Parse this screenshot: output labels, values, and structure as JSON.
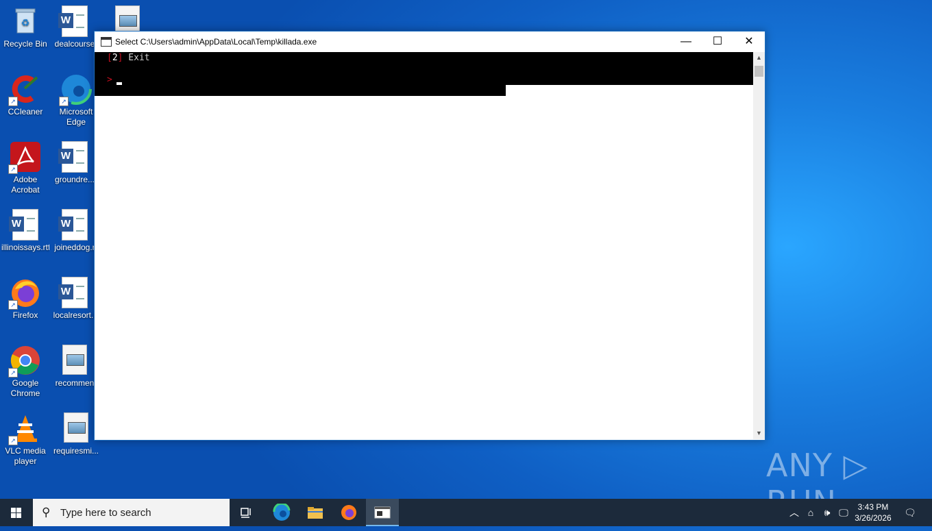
{
  "desktop": {
    "icons": [
      {
        "label": "Recycle Bin"
      },
      {
        "label": "dealcourse"
      },
      {
        "label": ""
      },
      {
        "label": "CCleaner"
      },
      {
        "label": "Microsoft Edge"
      },
      {
        "label": "Adobe Acrobat"
      },
      {
        "label": "groundre..."
      },
      {
        "label": "illinoissays.rtf"
      },
      {
        "label": "joineddog.r"
      },
      {
        "label": "Firefox"
      },
      {
        "label": "localresort.r"
      },
      {
        "label": "Google Chrome"
      },
      {
        "label": "recommen"
      },
      {
        "label": "VLC media player"
      },
      {
        "label": "requiresmi..."
      }
    ]
  },
  "console_window": {
    "title": "Select C:\\Users\\admin\\AppData\\Local\\Temp\\killada.exe",
    "lines": {
      "option_open": "[",
      "option_num": "2",
      "option_close": "]",
      "option_text": " Exit",
      "prompt": ">"
    },
    "buttons": {
      "minimize": "—",
      "maximize": "☐",
      "close": "✕"
    }
  },
  "taskbar": {
    "search_placeholder": "Type here to search",
    "clock_time": "3:43 PM",
    "clock_date": "3/26/2026"
  },
  "watermark": "ANY ▷ RUN",
  "colors": {
    "accent_red": "#c50f1f",
    "terminal_bg": "#000000"
  }
}
